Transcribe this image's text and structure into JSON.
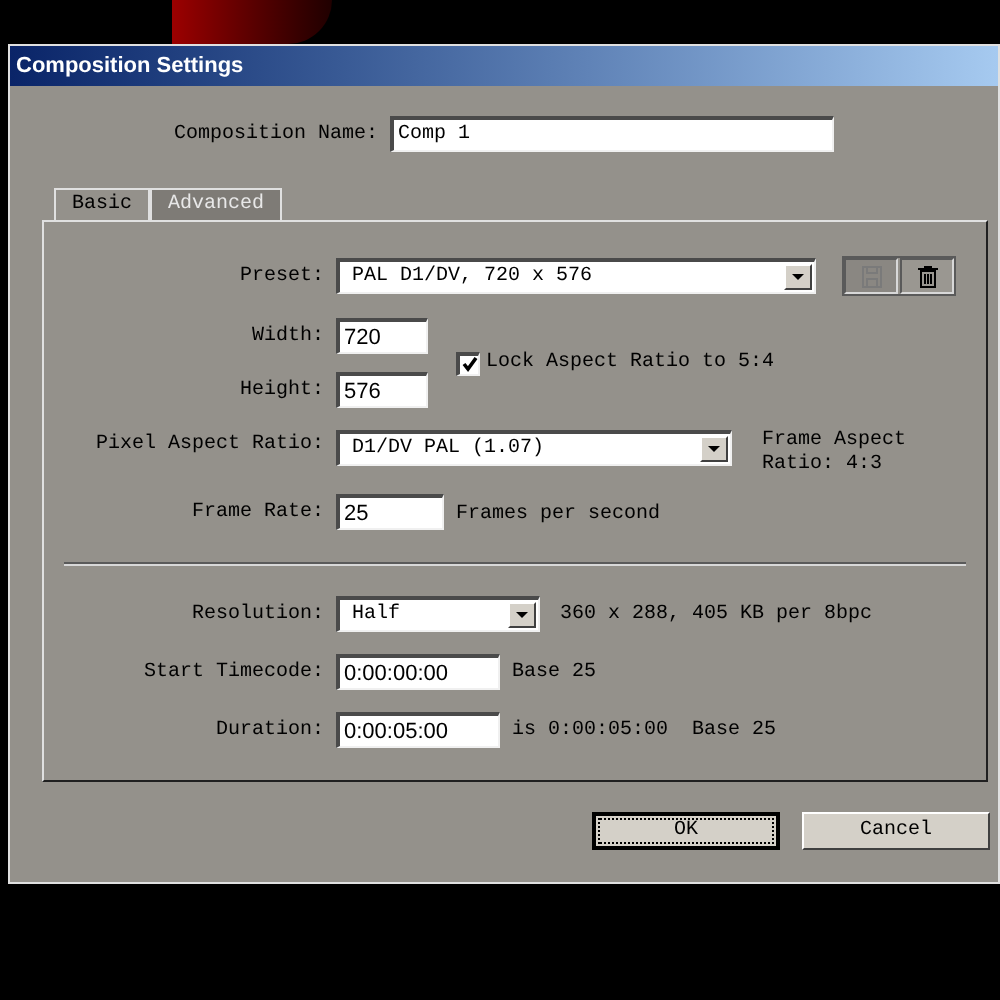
{
  "window": {
    "title": "Composition Settings"
  },
  "composition_name": {
    "label": "Composition Name:",
    "value": "Comp 1"
  },
  "tabs": [
    {
      "label": "Basic",
      "selected": true
    },
    {
      "label": "Advanced",
      "selected": false
    }
  ],
  "preset": {
    "label": "Preset:",
    "value": "PAL D1/DV, 720 x 576"
  },
  "preset_actions": [
    {
      "kind": "save",
      "disabled": true
    },
    {
      "kind": "delete",
      "disabled": false
    }
  ],
  "width": {
    "label": "Width:",
    "value": "720"
  },
  "height": {
    "label": "Height:",
    "value": "576"
  },
  "lock_aspect": {
    "label": "Lock Aspect Ratio to 5:4",
    "checked": true
  },
  "pixel_aspect": {
    "label": "Pixel Aspect Ratio:",
    "value": "D1/DV PAL (1.07)",
    "note": "Frame Aspect Ratio: 4:3"
  },
  "frame_rate": {
    "label": "Frame Rate:",
    "value": "25",
    "unit": "Frames per second"
  },
  "resolution": {
    "label": "Resolution:",
    "value": "Half",
    "note": "360 x 288, 405 KB per 8bpc"
  },
  "start_timecode": {
    "label": "Start Timecode:",
    "value": "0:00:00:00",
    "note": "Base 25"
  },
  "duration": {
    "label": "Duration:",
    "value": "0:00:05:00",
    "note": "is 0:00:05:00",
    "base": "Base 25"
  },
  "buttons": [
    {
      "label": "OK",
      "default": true
    },
    {
      "label": "Cancel",
      "default": false
    }
  ]
}
